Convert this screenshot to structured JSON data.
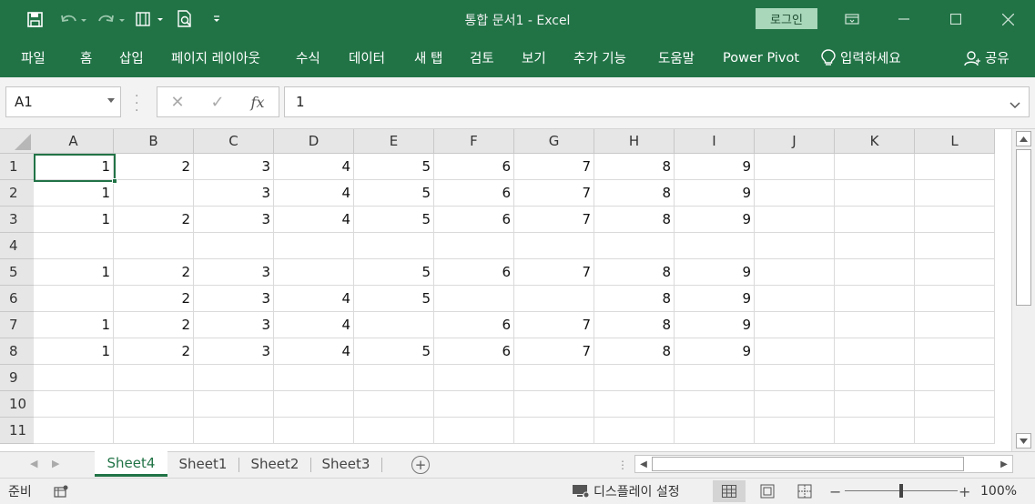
{
  "window": {
    "title": "통합 문서1  -  Excel",
    "login_label": "로그인"
  },
  "ribbon": {
    "tabs": [
      "파일",
      "홈",
      "삽입",
      "페이지 레이아웃",
      "수식",
      "데이터",
      "새 탭",
      "검토",
      "보기",
      "추가 기능",
      "도움말",
      "Power Pivot"
    ],
    "tell_me": "입력하세요",
    "share": "공유"
  },
  "formula_bar": {
    "name_box": "A1",
    "fx_label": "fx",
    "value": "1"
  },
  "grid": {
    "columns": [
      "A",
      "B",
      "C",
      "D",
      "E",
      "F",
      "G",
      "H",
      "I",
      "J",
      "K",
      "L"
    ],
    "rows": [
      "1",
      "2",
      "3",
      "4",
      "5",
      "6",
      "7",
      "8",
      "9",
      "10",
      "11"
    ],
    "cells": [
      [
        "1",
        "2",
        "3",
        "4",
        "5",
        "6",
        "7",
        "8",
        "9",
        "",
        "",
        ""
      ],
      [
        "1",
        "",
        "3",
        "4",
        "5",
        "6",
        "7",
        "8",
        "9",
        "",
        "",
        ""
      ],
      [
        "1",
        "2",
        "3",
        "4",
        "5",
        "6",
        "7",
        "8",
        "9",
        "",
        "",
        ""
      ],
      [
        "",
        "",
        "",
        "",
        "",
        "",
        "",
        "",
        "",
        "",
        "",
        ""
      ],
      [
        "1",
        "2",
        "3",
        "",
        "5",
        "6",
        "7",
        "8",
        "9",
        "",
        "",
        ""
      ],
      [
        "",
        "2",
        "3",
        "4",
        "5",
        "",
        "",
        "8",
        "9",
        "",
        "",
        ""
      ],
      [
        "1",
        "2",
        "3",
        "4",
        "",
        "6",
        "7",
        "8",
        "9",
        "",
        "",
        ""
      ],
      [
        "1",
        "2",
        "3",
        "4",
        "5",
        "6",
        "7",
        "8",
        "9",
        "",
        "",
        ""
      ],
      [
        "",
        "",
        "",
        "",
        "",
        "",
        "",
        "",
        "",
        "",
        "",
        ""
      ],
      [
        "",
        "",
        "",
        "",
        "",
        "",
        "",
        "",
        "",
        "",
        "",
        ""
      ],
      [
        "",
        "",
        "",
        "",
        "",
        "",
        "",
        "",
        "",
        "",
        "",
        ""
      ]
    ]
  },
  "sheets": {
    "tabs": [
      "Sheet4",
      "Sheet1",
      "Sheet2",
      "Sheet3"
    ],
    "active": "Sheet4"
  },
  "status": {
    "ready": "준비",
    "display_settings": "디스플레이 설정",
    "zoom": "100%",
    "zoom_fraction": 0.5
  },
  "colors": {
    "accent": "#217346",
    "login_bg": "#a8d7b9"
  }
}
